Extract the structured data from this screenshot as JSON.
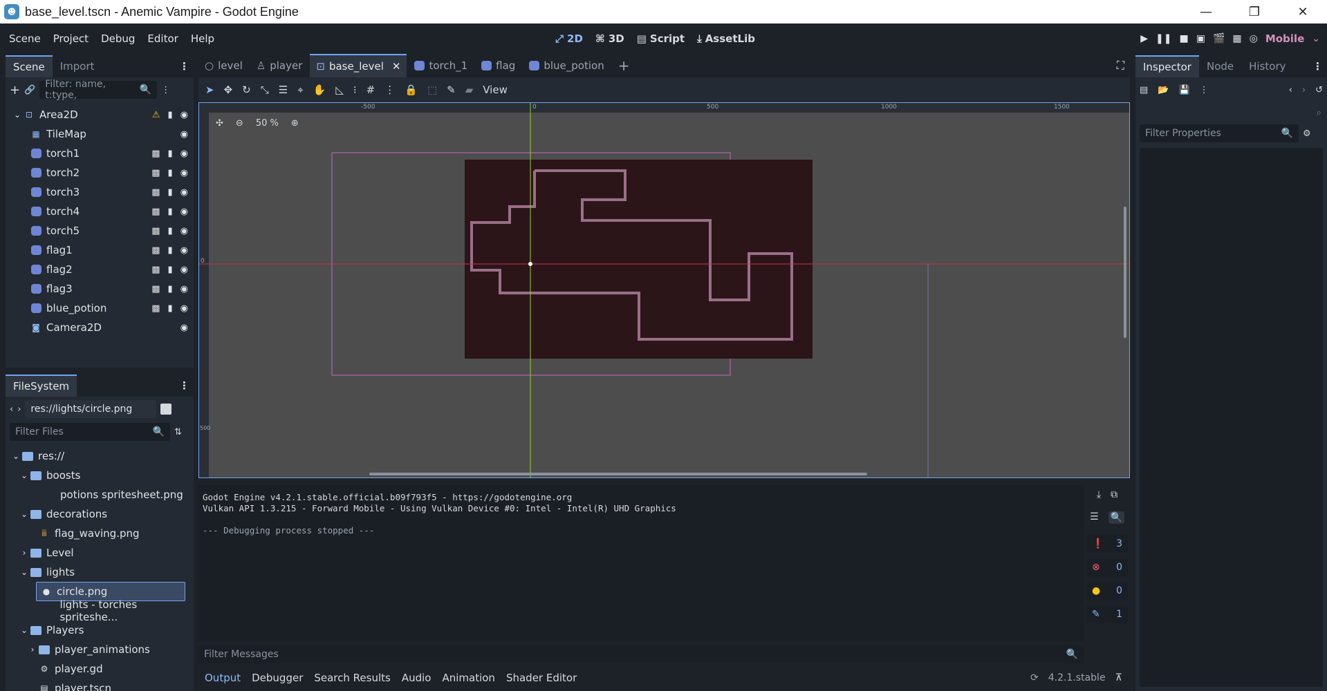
{
  "window": {
    "title": "base_level.tscn - Anemic Vampire - Godot Engine",
    "minimize": "—",
    "maximize": "❐",
    "close": "✕"
  },
  "menu": [
    "Scene",
    "Project",
    "Debug",
    "Editor",
    "Help"
  ],
  "main_modes": {
    "two_d": "2D",
    "three_d": "3D",
    "script": "Script",
    "assetlib": "AssetLib"
  },
  "renderer": "Mobile",
  "scene_dock": {
    "tabs": [
      "Scene",
      "Import"
    ],
    "filter_placeholder": "Filter: name, t:type,",
    "nodes": [
      {
        "name": "Area2D"
      },
      {
        "name": "TileMap"
      },
      {
        "name": "torch1"
      },
      {
        "name": "torch2"
      },
      {
        "name": "torch3"
      },
      {
        "name": "torch4"
      },
      {
        "name": "torch5"
      },
      {
        "name": "flag1"
      },
      {
        "name": "flag2"
      },
      {
        "name": "flag3"
      },
      {
        "name": "blue_potion"
      },
      {
        "name": "Camera2D"
      }
    ]
  },
  "filesystem": {
    "tab": "FileSystem",
    "path": "res://lights/circle.png",
    "filter_placeholder": "Filter Files",
    "items": [
      {
        "name": "res://"
      },
      {
        "name": "boosts"
      },
      {
        "name": "potions spritesheet.png"
      },
      {
        "name": "decorations"
      },
      {
        "name": "flag_waving.png"
      },
      {
        "name": "Level"
      },
      {
        "name": "lights"
      },
      {
        "name": "circle.png"
      },
      {
        "name": "lights - torches spriteshe..."
      },
      {
        "name": "Players"
      },
      {
        "name": "player_animations"
      },
      {
        "name": "player.gd"
      },
      {
        "name": "player.tscn"
      }
    ]
  },
  "editor_tabs": [
    "level",
    "player",
    "base_level",
    "torch_1",
    "flag",
    "blue_potion"
  ],
  "canvas_toolbar": {
    "view": "View",
    "zoom": "50 %"
  },
  "ruler": {
    "top": [
      "-500",
      "0",
      "500",
      "1000",
      "1500"
    ],
    "left": [
      "0",
      "500"
    ]
  },
  "output": {
    "lines": [
      "Godot Engine v4.2.1.stable.official.b09f793f5 - https://godotengine.org",
      "Vulkan API 1.3.215 - Forward Mobile - Using Vulkan Device #0: Intel - Intel(R) UHD Graphics",
      "",
      "--- Debugging process stopped ---"
    ],
    "filter_placeholder": "Filter Messages",
    "counts": {
      "messages": "3",
      "errors": "0",
      "warnings": "0",
      "editor": "1"
    }
  },
  "bottom_tabs": [
    "Output",
    "Debugger",
    "Search Results",
    "Audio",
    "Animation",
    "Shader Editor"
  ],
  "version": "4.2.1.stable",
  "inspector": {
    "tabs": [
      "Inspector",
      "Node",
      "History"
    ],
    "filter_placeholder": "Filter Properties"
  },
  "colors": {
    "accent": "#6fa4f0",
    "level_bg": "#2b1519",
    "level_wall": "#9a6f88"
  }
}
